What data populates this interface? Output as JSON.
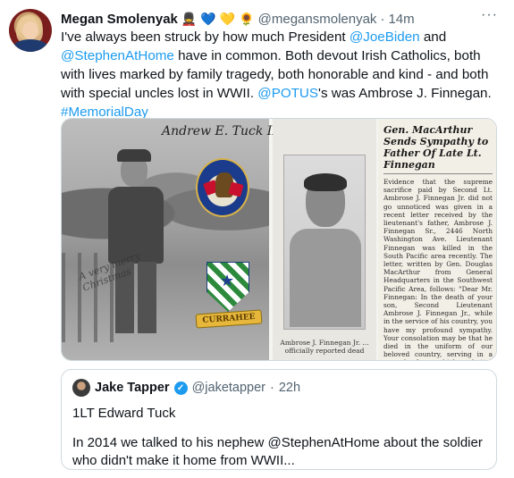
{
  "tweet": {
    "author_name": "Megan Smolenyak",
    "emojis": [
      "💂",
      "💙",
      "💛",
      "🌻"
    ],
    "handle": "@megansmolenyak",
    "dot": "·",
    "time": "14m",
    "more_label": "···",
    "text": {
      "p1": "I've always been struck by how much President ",
      "mention1": "@JoeBiden",
      "p2": " and ",
      "mention2": "@StephenAtHome",
      "p3": " have in common. Both devout Irish Catholics, both with lives marked by family tragedy, both honorable and kind - and both with special uncles lost in WWII. ",
      "mention3": "@POTUS",
      "p4": "'s was Ambrose J. Finnegan. ",
      "hashtag": "#MemorialDay"
    }
  },
  "media": {
    "top_caption": "Andrew E. Tuck II",
    "signature": "A very merry Christmas",
    "banner": "CURRAHEE",
    "mid_caption": "Ambrose J. Finnegan Jr. ... officially reported dead",
    "clipping_headline": "Gen. MacArthur Sends Sympathy to Father Of Late Lt. Finnegan",
    "clipping_body": "Evidence that the supreme sacrifice paid by Second Lt. Ambrose J. Finnegan Jr. did not go unnoticed was given in a recent letter received by the lieutenant's father, Ambrose J. Finnegan Sr., 2446 North Washington Ave. Lieutenant Finnegan was killed in the South Pacific area recently. The letter, written by Gen. Douglas MacArthur from General Headquarters in the Southwest Pacific Area, follows: \"Dear Mr. Finnegan: In the death of your son, Second Lieutenant Ambrose J. Finnegan Jr., while in the service of his country, you have my profound sympathy. Your consolation may be that he died in the uniform of our beloved country, serving in a crusade from which a better world for all will come. Very faithfully, DOUGLAS MacARTHUR.\""
  },
  "quote": {
    "author_name": "Jake Tapper",
    "verified_mark": "✓",
    "handle": "@jaketapper",
    "dot": "·",
    "time": "22h",
    "line1": "1LT Edward Tuck",
    "line2": "In 2014 we talked to his nephew @StephenAtHome about the soldier who didn't make it home from WWII..."
  },
  "colors": {
    "link": "#1d9bf0",
    "secondary_text": "#536471",
    "border": "#cfd9de"
  }
}
